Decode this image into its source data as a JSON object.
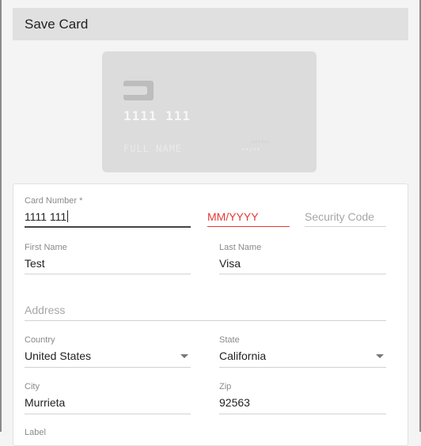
{
  "dialog": {
    "title": "Save Card"
  },
  "card_preview": {
    "number": "1111 111",
    "name": "FULL NAME",
    "expiry_label": "valid thru",
    "expiry": "••/••"
  },
  "form": {
    "card_number": {
      "label": "Card Number *",
      "value": "1111 111"
    },
    "expiry": {
      "placeholder": "MM/YYYY",
      "state": "error"
    },
    "security_code": {
      "placeholder": "Security Code"
    },
    "first_name": {
      "label": "First Name",
      "value": "Test"
    },
    "last_name": {
      "label": "Last Name",
      "value": "Visa"
    },
    "address": {
      "placeholder": "Address"
    },
    "country": {
      "label": "Country",
      "value": "United States"
    },
    "state": {
      "label": "State",
      "value": "California"
    },
    "city": {
      "label": "City",
      "value": "Murrieta"
    },
    "zip": {
      "label": "Zip",
      "value": "92563"
    },
    "next_label": "Label"
  },
  "colors": {
    "error": "#e53935",
    "header_bg": "#e0e0e0",
    "card_bg": "#dcdcdc"
  },
  "icons": {
    "card_chip": "chip-icon",
    "dropdown": "chevron-down-icon"
  }
}
